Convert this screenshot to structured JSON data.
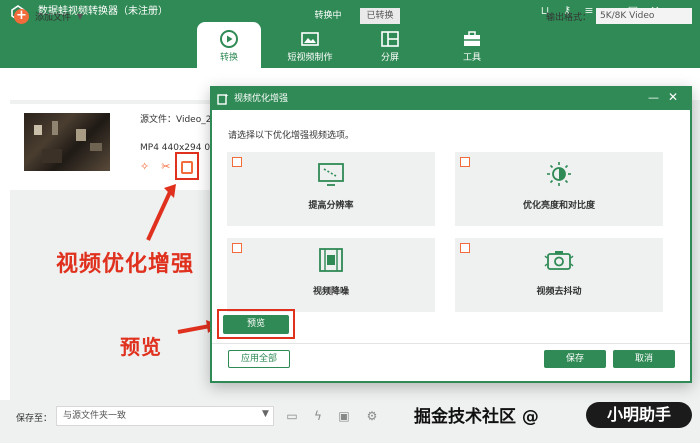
{
  "app": {
    "title": "数据蛙视频转换器（未注册）",
    "accent_color": "#2f8a55",
    "highlight_color": "#f26b3a",
    "annotation_color": "#e0301e"
  },
  "window_controls": [
    "cart-icon",
    "key-icon",
    "menu-icon",
    "minimize-icon",
    "maximize-icon",
    "close-icon"
  ],
  "nav": {
    "tabs": [
      {
        "label": "转换",
        "icon": "convert-icon",
        "active": true
      },
      {
        "label": "短视频制作",
        "icon": "image-icon",
        "active": false
      },
      {
        "label": "分屏",
        "icon": "split-screen-icon",
        "active": false
      },
      {
        "label": "工具",
        "icon": "toolbox-icon",
        "active": false
      }
    ]
  },
  "toolbar": {
    "add_file": "添加文件",
    "seg_converting": "转换中",
    "seg_converted": "已转换",
    "output_format_label": "输出格式：",
    "output_format_value": "5K/8K Video"
  },
  "file": {
    "source": "源文件：Video_2",
    "meta": "MP4  440x294  0",
    "actions": [
      "magic-wand-icon",
      "scissors-icon",
      "enhance-icon"
    ]
  },
  "annotations": {
    "enhance": "视频优化增强",
    "preview": "预览"
  },
  "dialog": {
    "title": "视频优化增强",
    "instruction": "请选择以下优化增强视频选项。",
    "options": [
      {
        "label": "提高分辨率",
        "icon": "upscale-icon",
        "checked": false
      },
      {
        "label": "优化亮度和对比度",
        "icon": "brightness-icon",
        "checked": false
      },
      {
        "label": "视频降噪",
        "icon": "denoise-film-icon",
        "checked": false
      },
      {
        "label": "视频去抖动",
        "icon": "deshake-camera-icon",
        "checked": false
      }
    ],
    "preview": "预览",
    "apply_all": "应用全部",
    "save": "保存",
    "cancel": "取消"
  },
  "bottom": {
    "save_to_label": "保存至：",
    "save_path": "与源文件夹一致",
    "icons": [
      "folder-icon",
      "speed-icon",
      "gpu-icon",
      "settings-icon"
    ]
  },
  "watermark": {
    "text": "掘金技术社区",
    "at": "@",
    "pill": "小明助手"
  }
}
